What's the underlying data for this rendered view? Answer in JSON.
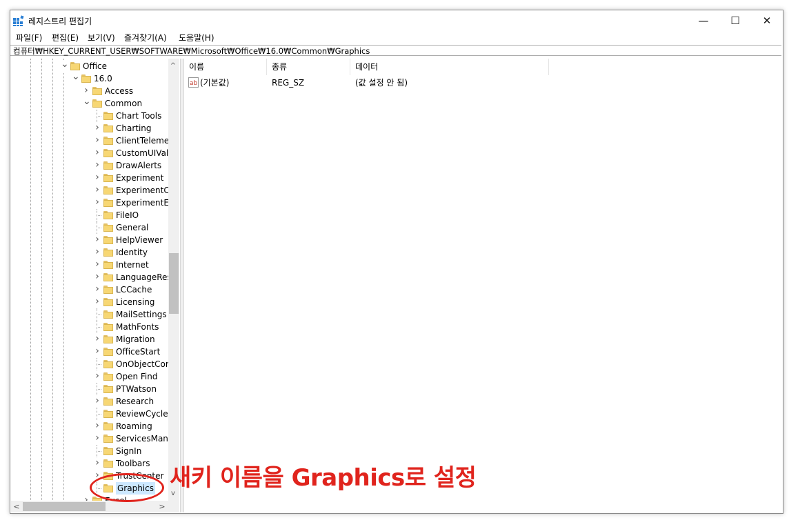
{
  "window": {
    "title": "레지스트리 편집기",
    "controls": [
      "—",
      "☐",
      "✕"
    ]
  },
  "menu": [
    "파일(F)",
    "편집(E)",
    "보기(V)",
    "즐겨찾기(A)",
    "도움말(H)"
  ],
  "address": "컴퓨터₩HKEY_CURRENT_USER₩SOFTWARE₩Microsoft₩Office₩16.0₩Common₩Graphics",
  "tree": [
    {
      "label": "Office",
      "level": 0,
      "expanded": true
    },
    {
      "label": "16.0",
      "level": 1,
      "expanded": true
    },
    {
      "label": "Access",
      "level": 2,
      "expandable": true
    },
    {
      "label": "Common",
      "level": 2,
      "expanded": true
    },
    {
      "label": "Chart Tools",
      "level": 3
    },
    {
      "label": "Charting",
      "level": 3,
      "expandable": true
    },
    {
      "label": "ClientTelemet",
      "level": 3,
      "expandable": true
    },
    {
      "label": "CustomUIValid",
      "level": 3,
      "expandable": true
    },
    {
      "label": "DrawAlerts",
      "level": 3,
      "expandable": true
    },
    {
      "label": "Experiment",
      "level": 3,
      "expandable": true
    },
    {
      "label": "ExperimentCo",
      "level": 3,
      "expandable": true
    },
    {
      "label": "ExperimentEcs",
      "level": 3,
      "expandable": true
    },
    {
      "label": "FileIO",
      "level": 3
    },
    {
      "label": "General",
      "level": 3
    },
    {
      "label": "HelpViewer",
      "level": 3,
      "expandable": true
    },
    {
      "label": "Identity",
      "level": 3,
      "expandable": true
    },
    {
      "label": "Internet",
      "level": 3,
      "expandable": true
    },
    {
      "label": "LanguageReso",
      "level": 3,
      "expandable": true
    },
    {
      "label": "LCCache",
      "level": 3,
      "expandable": true
    },
    {
      "label": "Licensing",
      "level": 3,
      "expandable": true
    },
    {
      "label": "MailSettings",
      "level": 3
    },
    {
      "label": "MathFonts",
      "level": 3
    },
    {
      "label": "Migration",
      "level": 3,
      "expandable": true
    },
    {
      "label": "OfficeStart",
      "level": 3,
      "expandable": true
    },
    {
      "label": "OnObjectCom",
      "level": 3
    },
    {
      "label": "Open Find",
      "level": 3,
      "expandable": true
    },
    {
      "label": "PTWatson",
      "level": 3
    },
    {
      "label": "Research",
      "level": 3,
      "expandable": true
    },
    {
      "label": "ReviewCycle",
      "level": 3
    },
    {
      "label": "Roaming",
      "level": 3,
      "expandable": true
    },
    {
      "label": "ServicesMana",
      "level": 3,
      "expandable": true
    },
    {
      "label": "SignIn",
      "level": 3
    },
    {
      "label": "Toolbars",
      "level": 3,
      "expandable": true
    },
    {
      "label": "TrustCenter",
      "level": 3,
      "expandable": true
    },
    {
      "label": "Graphics",
      "level": 3,
      "selected": true
    },
    {
      "label": "Excel",
      "level": 2,
      "expandable": true
    }
  ],
  "columns": [
    "이름",
    "종류",
    "데이터"
  ],
  "values": [
    {
      "name": "(기본값)",
      "type": "REG_SZ",
      "data": "(값 설정 안 됨)"
    }
  ],
  "annotation": "새키 이름을 Graphics로 설정",
  "colors": {
    "annotation": "#e0241d",
    "selection": "#cce8ff",
    "folder": "#f7d774"
  }
}
